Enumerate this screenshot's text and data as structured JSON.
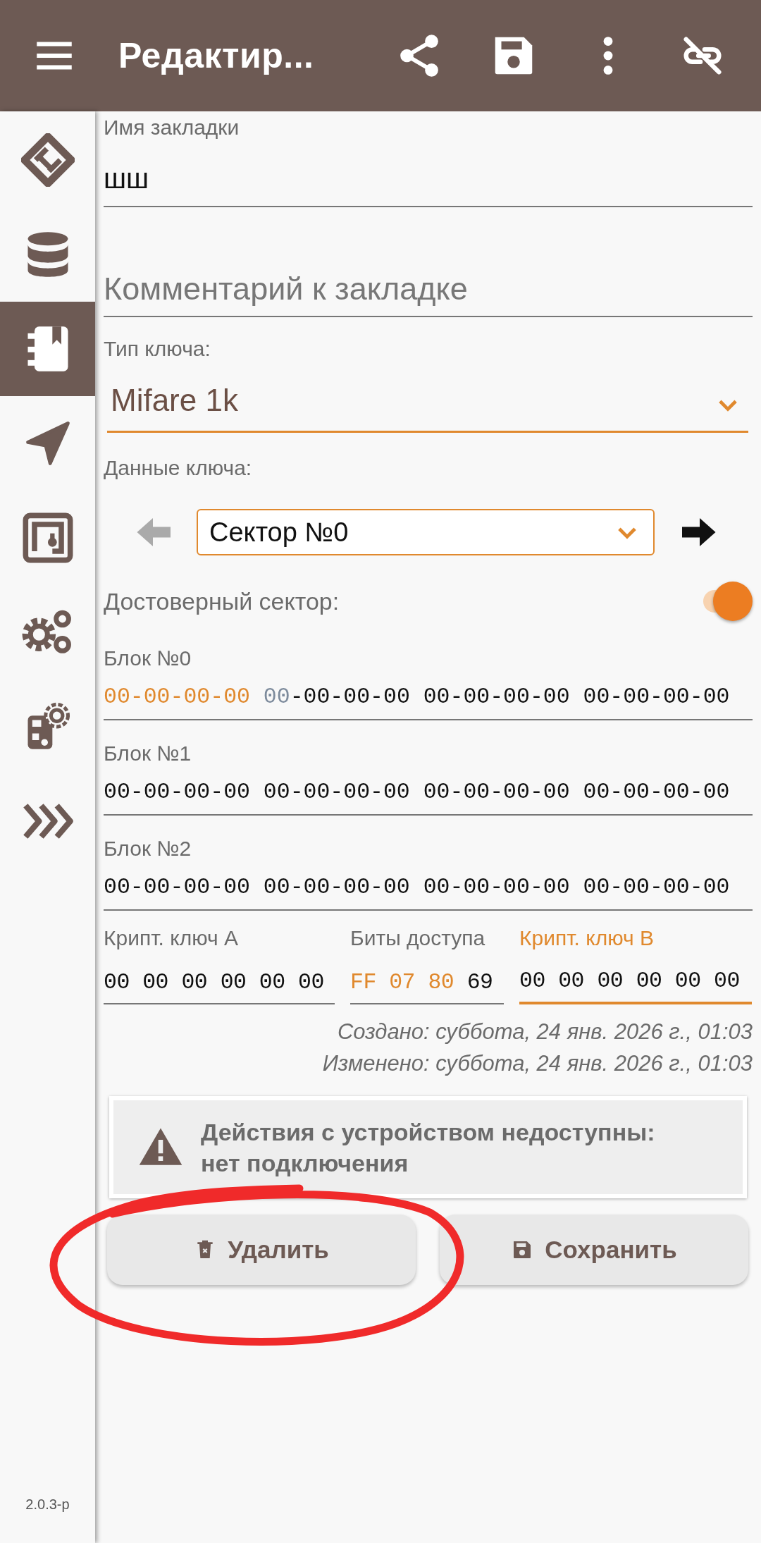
{
  "app_bar": {
    "title": "Редактир..."
  },
  "sidebar": {
    "items": [
      {
        "selected": false
      },
      {
        "selected": false
      },
      {
        "selected": true
      },
      {
        "selected": false
      },
      {
        "selected": false
      },
      {
        "selected": false
      },
      {
        "selected": false
      },
      {
        "selected": false
      }
    ],
    "version": "2.0.3-p"
  },
  "form": {
    "name": {
      "label": "Имя закладки",
      "value": "шш"
    },
    "comment": {
      "placeholder": "Комментарий к закладке"
    },
    "key_type": {
      "label": "Тип ключа:",
      "value": "Mifare 1k"
    },
    "key_data": {
      "label": "Данные ключа:",
      "prev_disabled": true,
      "next_disabled": false,
      "sector": "Сектор №0"
    },
    "valid_sector": {
      "label": "Достоверный сектор:",
      "on": true
    },
    "blocks": [
      {
        "label": "Блок №0",
        "segments": [
          {
            "text": "00-00-00-00",
            "kind": "highlight"
          },
          {
            "text": " 00",
            "kind": "muted"
          },
          {
            "text": "-00-00-00 00-00-00-00 00-00-00-00",
            "kind": "plain"
          }
        ]
      },
      {
        "label": "Блок №1",
        "segments": [
          {
            "text": "00-00-00-00 00-00-00-00 00-00-00-00 00-00-00-00",
            "kind": "plain"
          }
        ]
      },
      {
        "label": "Блок №2",
        "segments": [
          {
            "text": "00-00-00-00 00-00-00-00 00-00-00-00 00-00-00-00",
            "kind": "plain"
          }
        ]
      }
    ],
    "trailer": [
      {
        "label": "Крипт. ключ A",
        "focused": false,
        "segments": [
          {
            "text": "00 00 00 00 00 00",
            "kind": "plain"
          }
        ]
      },
      {
        "label": "Биты доступа",
        "focused": false,
        "segments": [
          {
            "text": "FF 07 80",
            "kind": "highlight"
          },
          {
            "text": " 69",
            "kind": "plain"
          }
        ]
      },
      {
        "label": "Крипт. ключ B",
        "focused": true,
        "segments": [
          {
            "text": "00 00 00 00 00 00",
            "kind": "plain"
          }
        ]
      }
    ],
    "created": "Создано: суббота, 24 янв. 2026 г., 01:03",
    "modified": "Изменено: суббота, 24 янв. 2026 г., 01:03"
  },
  "warning": {
    "text": "Действия с устройством недоступны: нет подключения"
  },
  "buttons": [
    {
      "label": "Удалить",
      "kind": "delete"
    },
    {
      "label": "Сохранить",
      "kind": "save"
    }
  ]
}
